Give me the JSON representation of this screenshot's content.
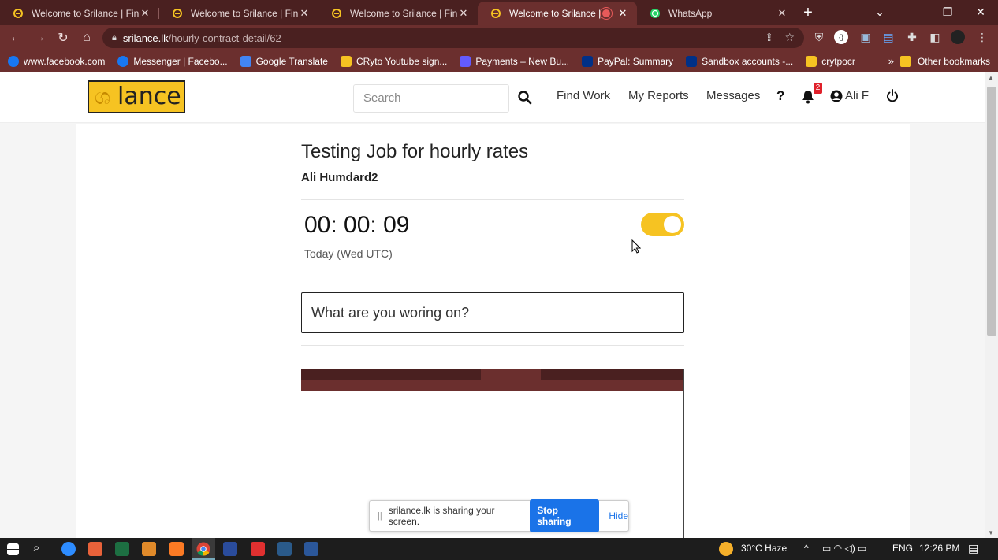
{
  "browser": {
    "tabs": [
      {
        "title": "Welcome to Srilance | Find D",
        "close": "✕",
        "active": false
      },
      {
        "title": "Welcome to Srilance | Find D",
        "close": "✕",
        "active": false
      },
      {
        "title": "Welcome to Srilance | Find D",
        "close": "✕",
        "active": false
      },
      {
        "title": "Welcome to Srilance | Fi",
        "close": "✕",
        "active": true
      },
      {
        "title": "WhatsApp",
        "close": "✕",
        "active": false
      }
    ],
    "new_tab": "+",
    "url_host": "srilance.lk",
    "url_path": "/hourly-contract-detail/62",
    "bookmarks": [
      {
        "label": "www.facebook.com",
        "icon": "facebook-icon",
        "color": "#1877f2"
      },
      {
        "label": "Messenger | Facebo...",
        "icon": "facebook-icon",
        "color": "#1877f2"
      },
      {
        "label": "Google Translate",
        "icon": "translate-icon",
        "color": "#4285f4"
      },
      {
        "label": "CRyto Youtube sign...",
        "icon": "folder-icon",
        "color": "#f6c322"
      },
      {
        "label": "Payments – New Bu...",
        "icon": "stripe-icon",
        "color": "#635bff"
      },
      {
        "label": "PayPal: Summary",
        "icon": "paypal-icon",
        "color": "#003087"
      },
      {
        "label": "Sandbox accounts -...",
        "icon": "paypal-icon",
        "color": "#003087"
      },
      {
        "label": "crytpocr",
        "icon": "folder-icon",
        "color": "#f6c322"
      }
    ],
    "bookmarks_more": "»",
    "other_bookmarks": "Other bookmarks"
  },
  "site": {
    "search_placeholder": "Search",
    "nav": {
      "find_work": "Find Work",
      "my_reports": "My Reports",
      "messages": "Messages",
      "help": "?",
      "notification_count": "2",
      "user": "Ali F"
    }
  },
  "contract": {
    "title": "Testing Job for hourly rates",
    "client": "Ali Humdard2",
    "timer": "00: 00: 09",
    "timer_label": "Today (Wed UTC)",
    "tracking_on": true,
    "task_placeholder": "What are you woring on?"
  },
  "share_bar": {
    "message": "srilance.lk is sharing your screen.",
    "stop": "Stop sharing",
    "hide": "Hide"
  },
  "taskbar": {
    "weather": "30°C  Haze",
    "lang": "ENG",
    "time": "12:26 PM"
  },
  "colors": {
    "brand_yellow": "#f6c322",
    "browser_frame": "#6b2f2e",
    "accent_blue": "#1a73e8"
  }
}
